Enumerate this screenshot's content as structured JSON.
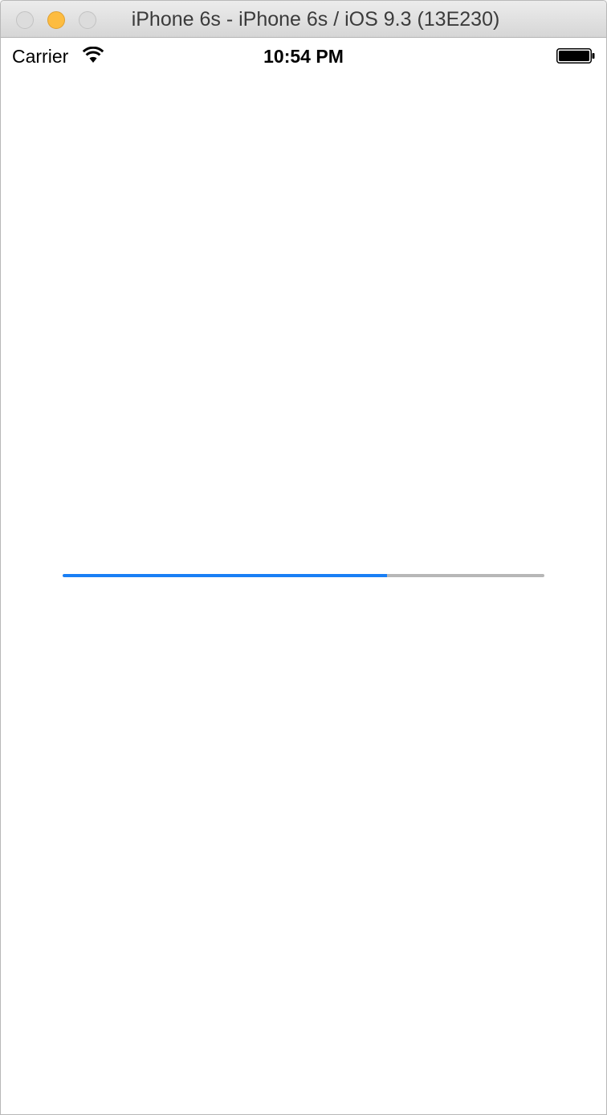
{
  "window": {
    "title": "iPhone 6s - iPhone 6s / iOS 9.3 (13E230)"
  },
  "status_bar": {
    "carrier": "Carrier",
    "time": "10:54 PM",
    "wifi_icon": "wifi-icon",
    "battery_icon": "battery-icon",
    "battery_level": 1.0
  },
  "progress_view": {
    "progress": 0.673,
    "track_color": "#b7b7b7",
    "fill_color": "#1a7ff5"
  },
  "colors": {
    "minimize_button": "#fdbc40",
    "inactive_button": "#dcdcdc"
  }
}
